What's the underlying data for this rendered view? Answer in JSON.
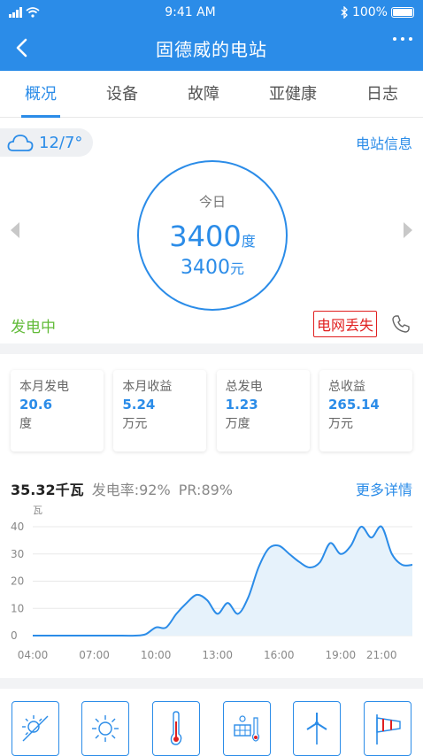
{
  "status_bar": {
    "time": "9:41 AM",
    "battery": "100%"
  },
  "nav": {
    "title": "固德威的电站"
  },
  "tabs": [
    "概况",
    "设备",
    "故障",
    "亚健康",
    "日志"
  ],
  "overview": {
    "weather": "12/7°",
    "station_info": "电站信息",
    "today_label": "今日",
    "today_energy": "3400",
    "energy_unit": "度",
    "today_income": "3400",
    "income_unit": "元",
    "gen_status": "发电中",
    "alarm": "电网丢失"
  },
  "stats": [
    {
      "label": "本月发电",
      "value": "20.6",
      "unit": "度"
    },
    {
      "label": "本月收益",
      "value": "5.24",
      "unit": "万元"
    },
    {
      "label": "总发电",
      "value": "1.23",
      "unit": "万度"
    },
    {
      "label": "总收益",
      "value": "265.14",
      "unit": "万元"
    }
  ],
  "chart_header": {
    "power": "35.32千瓦",
    "rate": "发电率:92%",
    "pr": "PR:89%",
    "more": "更多详情"
  },
  "chart_data": {
    "type": "area",
    "ylabel": "瓦",
    "ylim": [
      0,
      40
    ],
    "yticks": [
      0,
      10,
      20,
      30,
      40
    ],
    "xticks": [
      "04:00",
      "07:00",
      "10:00",
      "13:00",
      "16:00",
      "19:00",
      "21:00"
    ],
    "series": [
      {
        "x": [
          4,
          5,
          6,
          7,
          8,
          9,
          9.5,
          10,
          10.5,
          11,
          11.5,
          12,
          12.5,
          13,
          13.5,
          14,
          14.5,
          15,
          15.5,
          16,
          16.5,
          17,
          17.5,
          18,
          18.5,
          19,
          19.5,
          20,
          20.5,
          21,
          21.5,
          22,
          22.5
        ],
        "y": [
          0,
          0,
          0,
          0,
          0,
          0,
          0.5,
          3,
          3,
          8,
          12,
          15,
          13,
          8,
          12,
          8,
          14,
          25,
          32,
          33,
          30,
          27,
          25,
          27,
          34,
          30,
          33,
          40,
          36,
          40,
          30,
          26,
          26
        ]
      }
    ],
    "colors": {
      "line": "#2b8ce8",
      "fill": "#e6f2fb",
      "grid": "#e8e8e8"
    }
  },
  "bottom_icons": [
    "sun-day-icon",
    "sun-icon",
    "thermometer-icon",
    "solar-temp-icon",
    "wind-turbine-icon",
    "windsock-icon"
  ],
  "colors": {
    "accent": "#2b8ce8",
    "ok": "#61bb38",
    "alarm": "#e02020"
  }
}
